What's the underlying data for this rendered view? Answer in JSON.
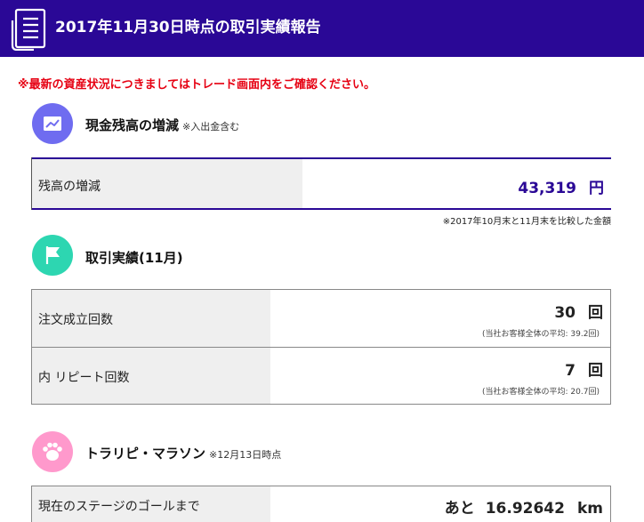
{
  "header": {
    "title": "2017年11月30日時点の取引実績報告",
    "icon": "report-list-icon"
  },
  "notice": "※最新の資産状況につきましてはトレード画面内をご確認ください。",
  "colors": {
    "header_bg": "#2a0896",
    "notice": "#e60012",
    "cash_icon": "#6f6cf0",
    "trade_icon": "#2dd6b1",
    "marathon_icon": "#ff99cc",
    "cash_value": "#2a0896"
  },
  "cash_section": {
    "icon": "trend-chart-icon",
    "title": "現金残高の増減",
    "subtitle": "※入出金含む",
    "row_label": "残高の増減",
    "value": "43,319",
    "unit": "円",
    "note": "※2017年10月末と11月末を比較した金額"
  },
  "trade_section": {
    "icon": "flag-icon",
    "title": "取引実績(11月)",
    "rows": [
      {
        "label": "注文成立回数",
        "value": "30",
        "unit": "回",
        "avg": "(当社お客様全体の平均: 39.2回)"
      },
      {
        "label": "内 リピート回数",
        "value": "7",
        "unit": "回",
        "avg": "(当社お客様全体の平均: 20.7回)"
      }
    ]
  },
  "marathon_section": {
    "icon": "paw-icon",
    "title": "トラリピ・マラソン",
    "subtitle": "※12月13日時点",
    "row_label": "現在のステージのゴールまで",
    "prefix": "あと",
    "value": "16.92642",
    "unit": "km"
  }
}
